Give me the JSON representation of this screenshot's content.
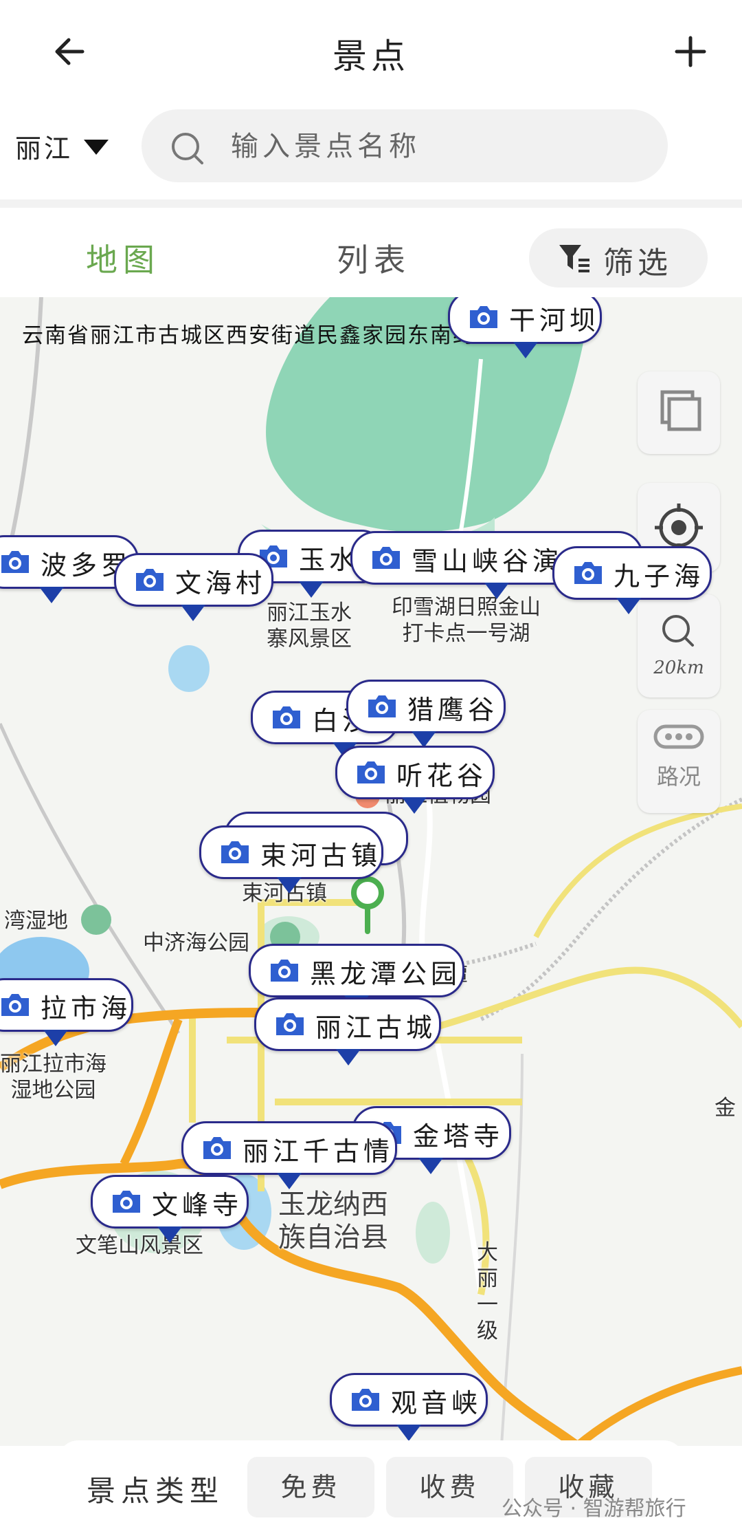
{
  "header": {
    "title": "景点"
  },
  "filter_bar": {
    "city": "丽江",
    "search_placeholder": "输入景点名称"
  },
  "tabs": [
    {
      "label": "地图"
    },
    {
      "label": "列表"
    }
  ],
  "filter_button": {
    "label": "筛选"
  },
  "map": {
    "address": "云南省丽江市古城区西安街道民鑫家园东南约61米",
    "controls": {
      "zoom_label": "20km",
      "traffic_label": "路况"
    },
    "pois": [
      {
        "label": "干河坝"
      },
      {
        "label": "波多罗"
      },
      {
        "label": "文海村"
      },
      {
        "label": "玉水寨"
      },
      {
        "label": "雪山峡谷演艺"
      },
      {
        "label": "九子海"
      },
      {
        "label": "白沙"
      },
      {
        "label": "猎鹰谷"
      },
      {
        "label": "听花谷"
      },
      {
        "label": "束河古镇"
      },
      {
        "label": "黑龙潭公园"
      },
      {
        "label": "拉市海"
      },
      {
        "label": "丽江古城"
      },
      {
        "label": "金塔寺"
      },
      {
        "label": "丽江千古情"
      },
      {
        "label": "文峰寺"
      },
      {
        "label": "观音峡"
      }
    ],
    "place_labels": {
      "yushuizhai": "丽江玉水\n寨风景区",
      "lake": "印雪湖日照金山\n打卡点一号湖",
      "botanic": "丽江植物园",
      "shuhe": "束河古镇",
      "wetland": "湾湿地",
      "zhongji": "中济海公园",
      "lashihai": "丽江拉市海\n湿地公园",
      "yulong": "玉龙纳西\n族自治县",
      "wenbi": "文笔山风景区",
      "dali": "大\n丽\n一\n级",
      "jin": "金",
      "tan": "潭"
    }
  },
  "bottom_bar": {
    "type_label": "景点类型",
    "chips": [
      "免费",
      "收费",
      "收藏"
    ]
  },
  "watermark": "公众号 · 智游帮旅行",
  "colors": {
    "accent_green": "#6aa84f",
    "marker_blue": "#1d3fa8",
    "border_navy": "#2a2a8a"
  }
}
